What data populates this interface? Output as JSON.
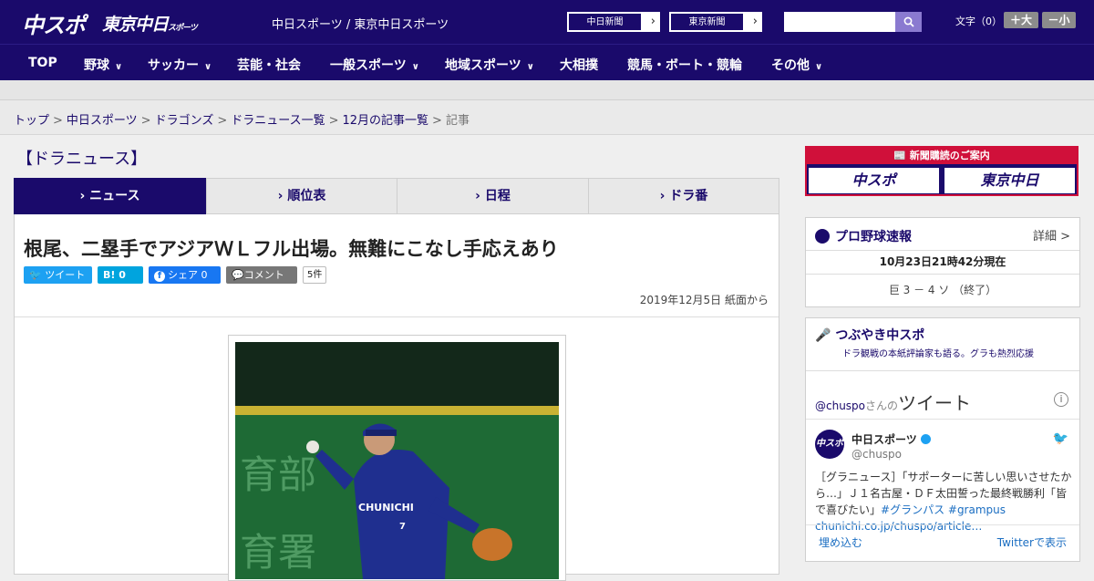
{
  "header": {
    "logo_primary": "中スポ",
    "logo_secondary": "東京中日",
    "logo_secondary_small": "スポーツ",
    "site_links": "中日スポーツ / 東京中日スポーツ",
    "ext_links": [
      "中日新聞",
      "東京新聞"
    ],
    "font_size_label": "文字（0）",
    "font_larger": "＋大",
    "font_smaller": "－小"
  },
  "nav": {
    "items": [
      {
        "label": "TOP",
        "dropdown": false
      },
      {
        "label": "野球",
        "dropdown": true
      },
      {
        "label": "サッカー",
        "dropdown": true
      },
      {
        "label": "芸能・社会",
        "dropdown": false
      },
      {
        "label": "一般スポーツ",
        "dropdown": true
      },
      {
        "label": "地域スポーツ",
        "dropdown": true
      },
      {
        "label": "大相撲",
        "dropdown": false
      },
      {
        "label": "競馬・ボート・競輪",
        "dropdown": false
      },
      {
        "label": "その他",
        "dropdown": true
      }
    ]
  },
  "breadcrumb": {
    "items": [
      "トップ",
      "中日スポーツ",
      "ドラゴンズ",
      "ドラニュース一覧",
      "12月の記事一覧"
    ],
    "current": "記事"
  },
  "section_title": "【ドラニュース】",
  "tabs": [
    {
      "label": "ニュース",
      "active": true
    },
    {
      "label": "順位表",
      "active": false
    },
    {
      "label": "日程",
      "active": false
    },
    {
      "label": "ドラ番",
      "active": false
    }
  ],
  "article": {
    "headline": "根尾、二塁手でアジアＷＬフル出場。無難にこなし手応えあり",
    "share": {
      "tweet": "ツイート",
      "hatena": "B! 0",
      "facebook": "シェア 0",
      "comment": "コメント",
      "comment_count": "5件"
    },
    "date": "2019年12月5日 紙面から",
    "photo_alt": "CHUNICHI"
  },
  "sidebar": {
    "promo": {
      "heading": "新聞購読のご案内",
      "logos": [
        "中スポ",
        "東京中日"
      ]
    },
    "scores": {
      "title": "プロ野球速報",
      "detail": "詳細 >",
      "timestamp": "10月23日21時42分現在",
      "line": "巨 3 － 4 ソ （終了）"
    },
    "twitter": {
      "title": "つぶやき中スポ",
      "subtitle": "ドラ観戦の本紙評論家も語る。グラも熱烈応援",
      "handle_prefix": "@chuspo",
      "handle_suffix": "さんの",
      "tweets_label": "ツイート",
      "account_name": "中日スポーツ",
      "account_handle": "@chuspo",
      "avatar_text": "中スポ",
      "tweet_text": "［グラニュース］「サポーターに苦しい思いさせたから…」Ｊ１名古屋・ＤＦ太田誓った最終戦勝利「皆で喜びたい」",
      "tweet_tags": "#グランパス #grampus",
      "tweet_link": "chunichi.co.jp/chuspo/article…",
      "embed": "埋め込む",
      "view_on": "Twitterで表示"
    }
  },
  "colors": {
    "brand_navy": "#1a0a6b",
    "promo_red": "#d0103a",
    "twitter_blue": "#1da1f2",
    "facebook_blue": "#1877f2"
  }
}
